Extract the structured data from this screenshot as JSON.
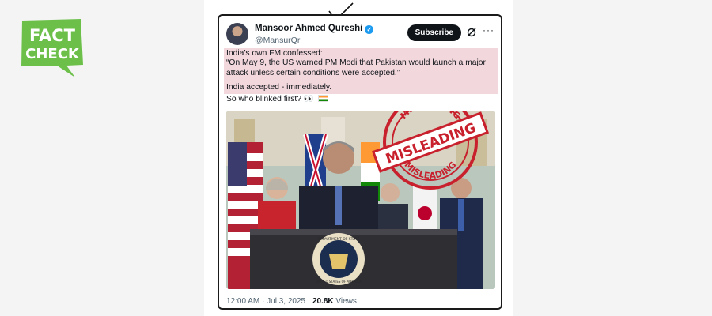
{
  "logo": {
    "line1": "FACT",
    "line2": "CHECK",
    "color": "#6cc04a"
  },
  "tweet": {
    "author_name": "Mansoor Ahmed Qureshi",
    "handle": "@MansurQr",
    "subscribe_label": "Subscribe",
    "more_label": "···",
    "line1": "India’s own FM confessed:",
    "line2": "“On May 9, the US warned PM Modi that Pakistan would launch a major attack unless certain conditions were accepted.”",
    "line3": "India accepted - immediately.",
    "line4": "So who blinked first?",
    "line4_emoji": "👀",
    "time": "12:00 AM · Jul 3, 2025 ·",
    "views_count": "20.8K",
    "views_label": "Views",
    "highlight_color": "#f2d7dc"
  },
  "stamp": {
    "top_arc": "MISLEADING",
    "banner": "MISLEADING",
    "bottom_arc": "MISLEADING",
    "color": "#c8202c"
  },
  "photo": {
    "seal_top": "DEPARTMENT OF STATE",
    "seal_bottom": "UNITED STATES OF AMERICA"
  }
}
